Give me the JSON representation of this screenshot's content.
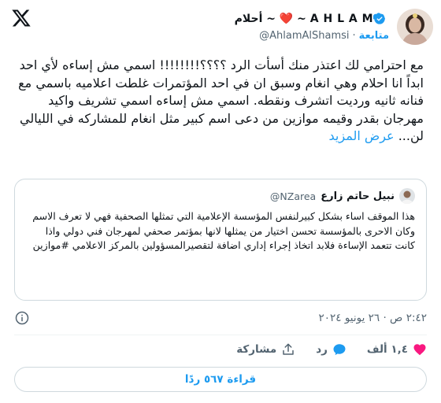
{
  "header": {
    "display_name": "أحلام ~ ❤️ ~ A H L A M",
    "handle": "@AhlamAlShamsi",
    "separator": "·",
    "follow_label": "متابعة"
  },
  "tweet": {
    "text": "مع احترامي لك اعتذر منك أسأت الرد ؟؟؟؟!!!!!!!! اسمي مش إساءه لأي احد  ابداً انا احلام وهي انغام وسبق ان في احد المؤتمرات غلطت اعلاميه باسمي مع فنانه ثانيه ورديت اتشرف ونقطه. اسمي مش إساءه اسمي تشريف واكيد مهرجان بقدر وقيمه موازين من دعى اسم كبير مثل انغام للمشاركه في الليالي لن...",
    "show_more": "عرض المزيد"
  },
  "quote": {
    "name": "نبيل حاتم زارع",
    "handle": "@NZarea",
    "text": "هذا الموقف اساء بشكل كبيرلنفس المؤسسة الإعلامية التي تمثلها الصحفية فهي لا تعرف الاسم وكان الاحرى بالمؤسسة تحسن اختيار من يمثلها لانها بمؤتمر صحفي لمهرجان فني دولي واذا كانت تتعمد الإساءة فلابد اتخاذ إجراء إداري اضافة لتقصيرالمسؤولين بالمركز الاعلامي #موازين"
  },
  "meta": {
    "timestamp": "٢:٤٢ ص · ٢٦ يونيو ٢٠٢٤"
  },
  "actions": {
    "likes": "١,٤ ألف",
    "reply_label": "رد",
    "share_label": "مشاركة"
  },
  "replies_button": "قراءة ٥٦٧ ردًا",
  "colors": {
    "accent": "#1d9bf0",
    "like": "#f91880",
    "muted": "#536471",
    "border": "#cfd9de"
  }
}
